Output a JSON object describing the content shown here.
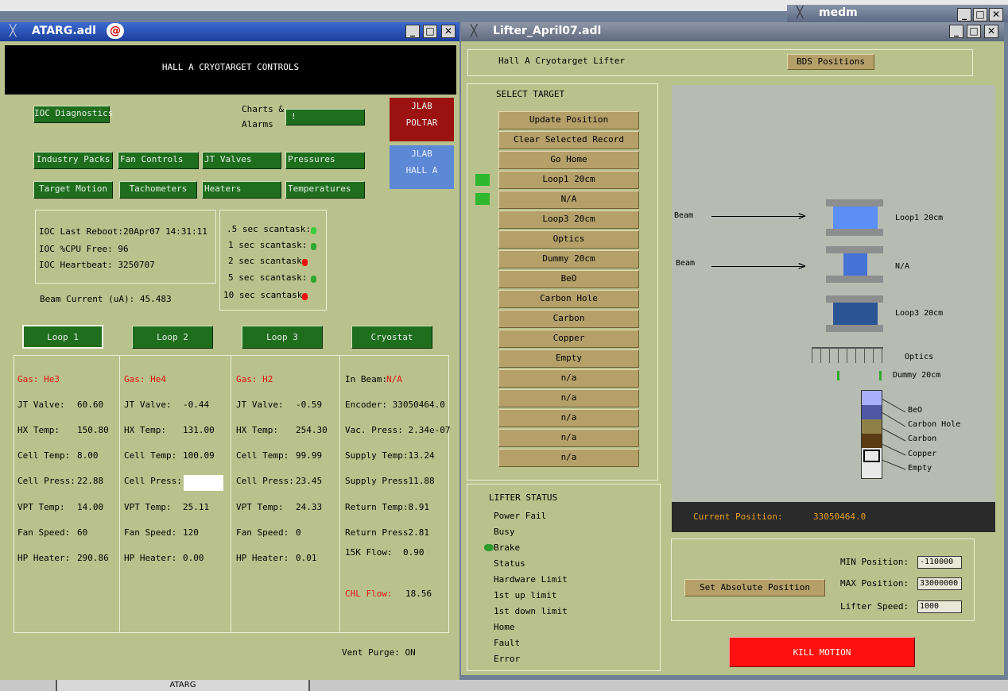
{
  "desktop": {
    "taskbar_label": "ATARG",
    "medm_title": "medm"
  },
  "atarg": {
    "title": "ATARG.adl",
    "banner": "HALL A CRYOTARGET CONTROLS",
    "ioc_diagnostics": "IOC Diagnostics",
    "charts_label": "Charts &",
    "alarms_label": "Alarms",
    "charts_menu_value": "!",
    "jlab_poltar": [
      "JLAB",
      "POLTAR"
    ],
    "jlab_halla": [
      "JLAB",
      "HALL A"
    ],
    "nav_row1": [
      "Industry Packs",
      "Fan Controls",
      "JT Valves",
      "Pressures"
    ],
    "nav_row2": [
      "Target Motion",
      "Tachometers",
      "Heaters",
      "Temperatures"
    ],
    "ioc": {
      "last_reboot": "IOC Last Reboot:20Apr07 14:31:11",
      "cpu_free": "IOC %CPU Free:  96",
      "heartbeat": "IOC Heartbeat:  3250707"
    },
    "scantasks": [
      {
        "label": ".5 sec scantask:",
        "status": "ok"
      },
      {
        "label": "1 sec scantask:",
        "status": "ok"
      },
      {
        "label": "2 sec scantask:",
        "status": "fail"
      },
      {
        "label": "5 sec scantask:",
        "status": "ok"
      },
      {
        "label": "10 sec scantask:",
        "status": "fail"
      }
    ],
    "beam_current": "Beam Current (uA): 45.483",
    "loop_tabs": [
      "Loop 1",
      "Loop 2",
      "Loop 3",
      "Cryostat"
    ],
    "loops": [
      {
        "gas": "Gas: He3",
        "rows": [
          [
            "JT Valve:",
            "60.60"
          ],
          [
            "HX Temp:",
            "150.80"
          ],
          [
            "Cell Temp:",
            "8.00"
          ],
          [
            "Cell Press:",
            "22.88"
          ],
          [
            "VPT Temp:",
            "14.00"
          ],
          [
            "Fan Speed:",
            "60"
          ],
          [
            "HP Heater:",
            "290.86"
          ]
        ]
      },
      {
        "gas": "Gas: He4",
        "rows": [
          [
            "JT Valve:",
            "-0.44"
          ],
          [
            "HX Temp:",
            "131.00"
          ],
          [
            "Cell Temp:",
            "100.09"
          ],
          [
            "Cell Press:",
            ""
          ],
          [
            "VPT Temp:",
            "25.11"
          ],
          [
            "Fan Speed:",
            "120"
          ],
          [
            "HP Heater:",
            "0.00"
          ]
        ]
      },
      {
        "gas": "Gas: H2",
        "rows": [
          [
            "JT Valve:",
            "-0.59"
          ],
          [
            "HX Temp:",
            "254.30"
          ],
          [
            "Cell Temp:",
            "99.99"
          ],
          [
            "Cell Press:",
            "23.45"
          ],
          [
            "VPT Temp:",
            "24.33"
          ],
          [
            "Fan Speed:",
            "0"
          ],
          [
            "HP Heater:",
            "0.01"
          ]
        ]
      }
    ],
    "cryostat": {
      "in_beam_label": "In Beam:",
      "in_beam_value": "N/A",
      "encoder": "Encoder: 33050464.0",
      "vac_press": "Vac. Press: 2.34e-07",
      "supply_temp": "Supply Temp:13.24",
      "supply_press": "Supply Press11.88",
      "return_temp": "Return Temp:8.91",
      "return_press": "Return Press2.81",
      "flow_15k_label": "15K Flow:",
      "flow_15k_value": "0.90",
      "chl_flow_label": "CHL Flow:",
      "chl_flow_value": "18.56"
    },
    "vent_purge": "Vent Purge: ON"
  },
  "lifter": {
    "title": "Lifter_April07.adl",
    "header": "Hall A  Cryotarget Lifter",
    "bds_button": "BDS Positions",
    "select_target": "SELECT TARGET",
    "targets": [
      "Update Position",
      "Clear Selected Record",
      "Go Home",
      "Loop1 20cm",
      "N/A",
      "Loop3 20cm",
      "Optics",
      "Dummy 20cm",
      "BeO",
      "Carbon Hole",
      "Carbon",
      "Copper",
      "Empty",
      "n/a",
      "n/a",
      "n/a",
      "n/a",
      "n/a"
    ],
    "status_title": "LIFTER STATUS",
    "status_items": [
      "Power Fail",
      "Busy",
      "Brake",
      "Status",
      "Hardware Limit",
      "1st up limit",
      "1st down limit",
      "Home",
      "Fault",
      "Error"
    ],
    "diagram": {
      "beam1": "Beam",
      "beam2": "Beam",
      "loop1": "Loop1 20cm",
      "na": "N/A",
      "loop3": "Loop3 20cm",
      "optics": "Optics",
      "dummy": "Dummy 20cm",
      "solids": [
        "BeO",
        "Carbon Hole",
        "Carbon",
        "Copper",
        "Empty"
      ]
    },
    "current_position_label": "Current Position:",
    "current_position_value": "33050464.0",
    "set_abs_button": "Set Absolute Position",
    "min_label": "MIN Position:",
    "min_value": "-110000",
    "max_label": "MAX Position:",
    "max_value": "33000000",
    "speed_label": "Lifter Speed:",
    "speed_value": "1000",
    "kill_button": "KILL MOTION",
    "colors": {
      "loop1": "#5b8ff5",
      "na": "#4472d6",
      "loop3": "#2b5594",
      "beo": "#a8aef8",
      "carbon_hole": "#4f58a6",
      "carbon": "#8f8047",
      "copper": "#5d3b12"
    }
  }
}
